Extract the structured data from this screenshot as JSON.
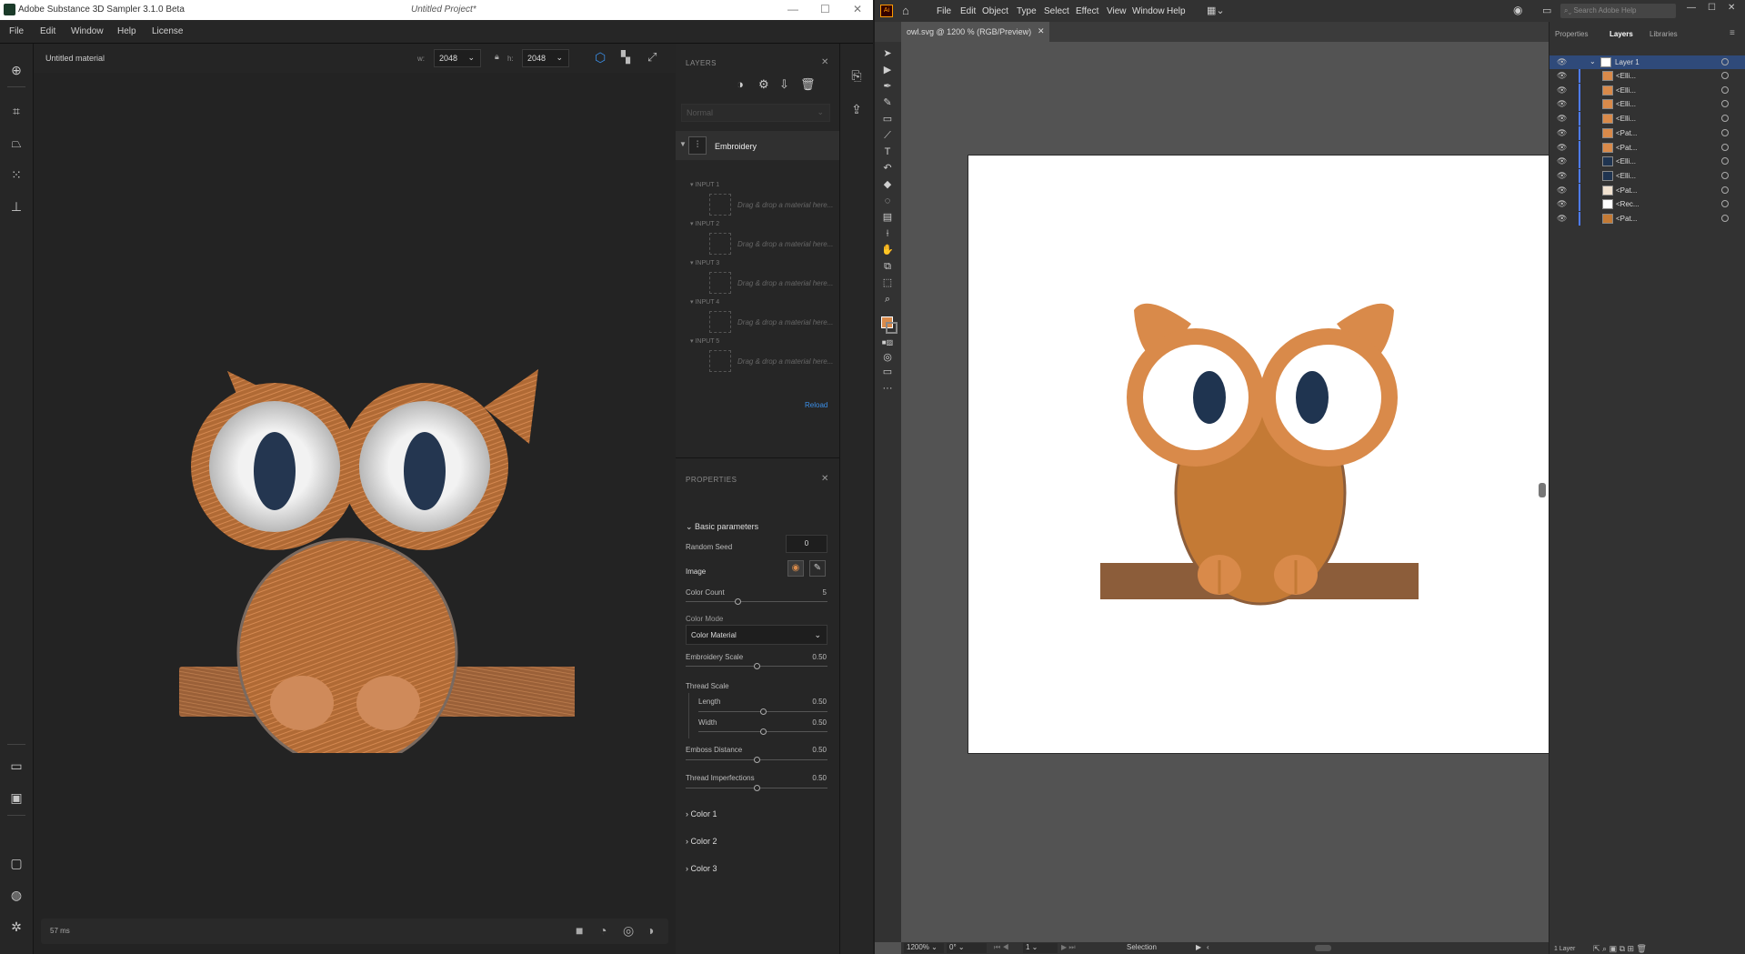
{
  "substance": {
    "title": "Adobe Substance 3D Sampler 3.1.0 Beta",
    "project": "Untitled Project*",
    "menu": [
      "File",
      "Edit",
      "Window",
      "Help",
      "License"
    ],
    "material_name": "Untitled material",
    "width_label": "w:",
    "width_value": "2048",
    "height_label": "h:",
    "height_value": "2048",
    "timing": "57 ms",
    "layers": {
      "header": "LAYERS",
      "blend_mode": "Normal",
      "layer_name": "Embroidery",
      "inputs": [
        {
          "label": "INPUT 1",
          "drop": "Drag & drop a material here..."
        },
        {
          "label": "INPUT 2",
          "drop": "Drag & drop a material here..."
        },
        {
          "label": "INPUT 3",
          "drop": "Drag & drop a material here..."
        },
        {
          "label": "INPUT 4",
          "drop": "Drag & drop a material here..."
        },
        {
          "label": "INPUT 5",
          "drop": "Drag & drop a material here..."
        }
      ],
      "reload": "Reload"
    },
    "properties": {
      "header": "PROPERTIES",
      "section": "Basic parameters",
      "random_seed_label": "Random Seed",
      "random_seed_value": "0",
      "image_label": "Image",
      "color_count_label": "Color Count",
      "color_count_value": "5",
      "color_count_level": 0.5,
      "color_mode_label": "Color Mode",
      "color_mode_value": "Color Material",
      "embroidery_scale_label": "Embroidery Scale",
      "embroidery_scale_value": "0.50",
      "thread_scale_label": "Thread Scale",
      "length_label": "Length",
      "length_value": "0.50",
      "width_label": "Width",
      "width_value": "0.50",
      "emboss_label": "Emboss Distance",
      "emboss_value": "0.50",
      "imperf_label": "Thread Imperfections",
      "imperf_value": "0.50",
      "color_sections": [
        "Color 1",
        "Color 2",
        "Color 3"
      ]
    }
  },
  "illustrator": {
    "menu": [
      "File",
      "Edit",
      "Object",
      "Type",
      "Select",
      "Effect",
      "View",
      "Window",
      "Help"
    ],
    "search_placeholder": "Search Adobe Help",
    "doc_tab": "owl.svg @ 1200 % (RGB/Preview)",
    "panel_tabs": [
      "Properties",
      "Layers",
      "Libraries"
    ],
    "layer_top": "Layer 1",
    "sublayers": [
      "<Elli...",
      "<Elli...",
      "<Elli...",
      "<Elli...",
      "<Pat...",
      "<Pat...",
      "<Elli...",
      "<Elli...",
      "<Pat...",
      "<Rec...",
      "<Pat..."
    ],
    "layers_count": "1 Layer",
    "zoom": "1200%",
    "rotation": "0°",
    "artboard_num": "1",
    "status": "Selection"
  },
  "colors": {
    "owl_orange": "#d98a4a",
    "owl_body": "#c47a35",
    "eye_navy": "#1f3450",
    "branch": "#8c5d3a",
    "ai_selected": "#4d7cff"
  }
}
